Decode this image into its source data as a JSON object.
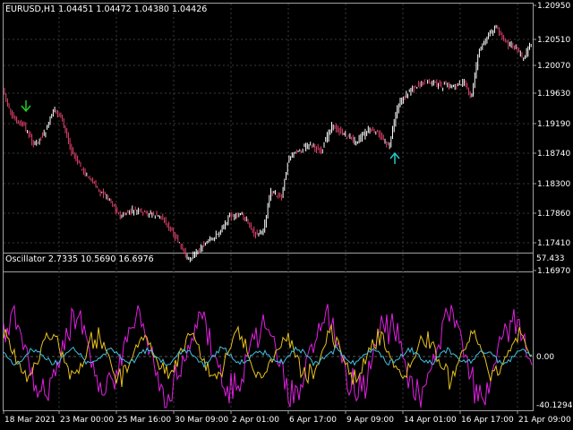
{
  "main_chart": {
    "title": "EURUSD,H1  1.04451 1.04472 1.04380 1.04426",
    "price_labels": [
      "1.20950",
      "1.20510",
      "1.20070",
      "1.19630",
      "1.19190",
      "1.18740",
      "1.18300",
      "1.17860",
      "1.17410",
      "1.16970"
    ],
    "signals": [
      {
        "type": "sell-arrow",
        "color": "#22cc22"
      },
      {
        "type": "buy-arrow",
        "color": "#22cccc"
      }
    ]
  },
  "oscillator": {
    "title": "Oscillator 2.7335 10.5690 16.6976",
    "levels": [
      "57.433",
      "0.00",
      "-40.1294"
    ],
    "colors": {
      "magenta": "#e020e0",
      "yellow": "#e8c020",
      "cyan": "#40c0e0"
    }
  },
  "time_labels": [
    "18 Mar 2021",
    "23 Mar 00:00",
    "25 Mar 16:00",
    "30 Mar 09:00",
    "2 Apr 01:00",
    "6 Apr 17:00",
    "9 Apr 09:00",
    "14 Apr 01:00",
    "16 Apr 17:00",
    "21 Apr 09:00"
  ],
  "colors": {
    "bull": "#ffffff",
    "bear": "#e0406a",
    "grid": "#3a3a3a",
    "frame": "#a0a0a0"
  }
}
